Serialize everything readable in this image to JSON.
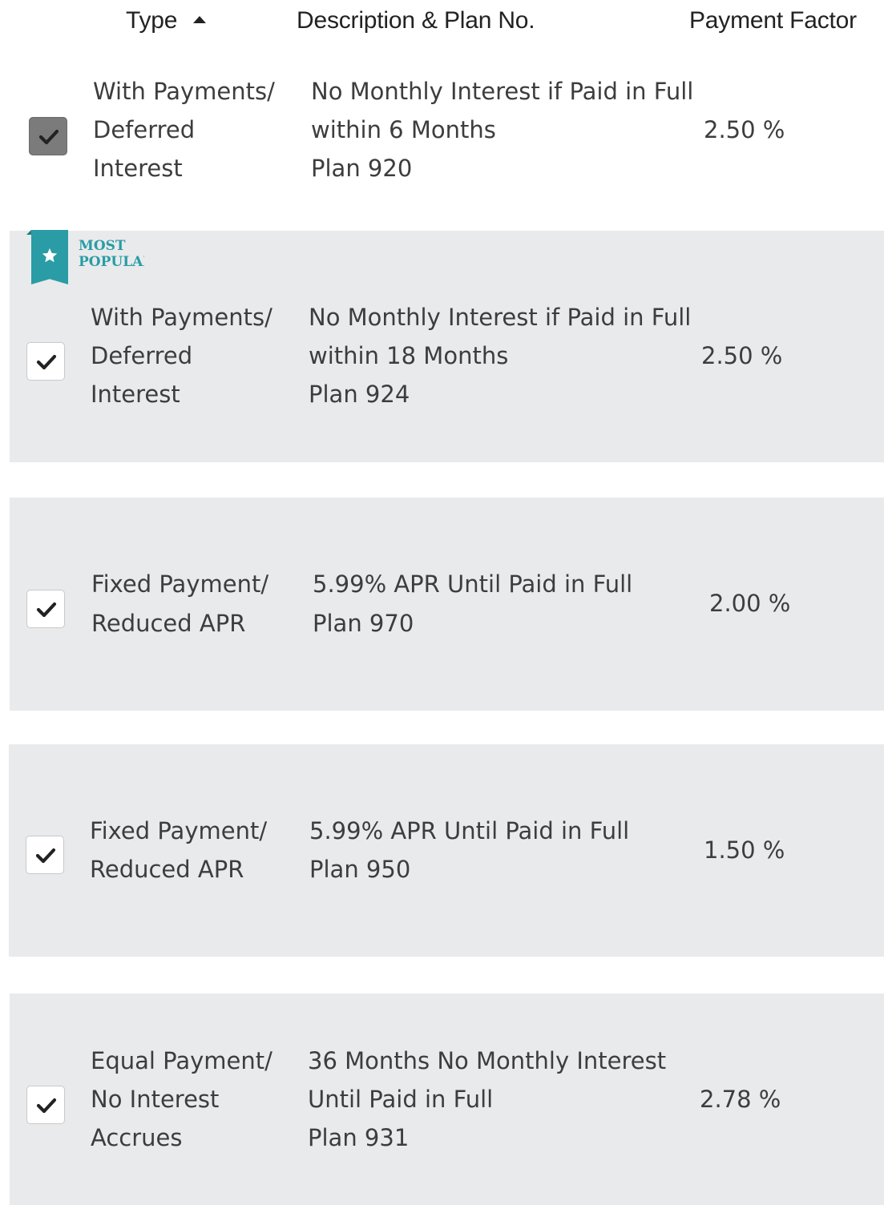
{
  "header": {
    "type_label": "Type",
    "description_label": "Description & Plan No.",
    "factor_label": "Payment Factor",
    "sort_icon": "sort-ascending-icon"
  },
  "badge": {
    "icon": "star-ribbon-icon",
    "line1": "MOST",
    "line2": "POPULAR"
  },
  "colors": {
    "shaded_row": "#e9eaec",
    "accent": "#2a9ca5",
    "text": "#3d3d3d"
  },
  "rows": [
    {
      "checked": true,
      "type": [
        "With Payments/",
        "Deferred",
        "Interest"
      ],
      "description": [
        "No Monthly Interest if Paid in Full",
        "within 6 Months",
        "Plan 920"
      ],
      "factor": "2.50 %"
    },
    {
      "checked": true,
      "type": [
        "With Payments/",
        "Deferred",
        "Interest"
      ],
      "description": [
        "No Monthly Interest if Paid in Full",
        "within 18 Months",
        "Plan 924"
      ],
      "factor": "2.50 %"
    },
    {
      "checked": true,
      "type": [
        "Fixed Payment/",
        "Reduced APR"
      ],
      "description": [
        "5.99% APR Until Paid in Full",
        "Plan 970"
      ],
      "factor": "2.00 %"
    },
    {
      "checked": true,
      "type": [
        "Fixed Payment/",
        "Reduced APR"
      ],
      "description": [
        "5.99% APR Until Paid in Full",
        "Plan 950"
      ],
      "factor": "1.50 %"
    },
    {
      "checked": true,
      "type": [
        "Equal Payment/",
        "No Interest",
        "Accrues"
      ],
      "description": [
        "36 Months No Monthly Interest",
        "Until Paid in Full",
        "Plan 931"
      ],
      "factor": "2.78 %"
    }
  ]
}
